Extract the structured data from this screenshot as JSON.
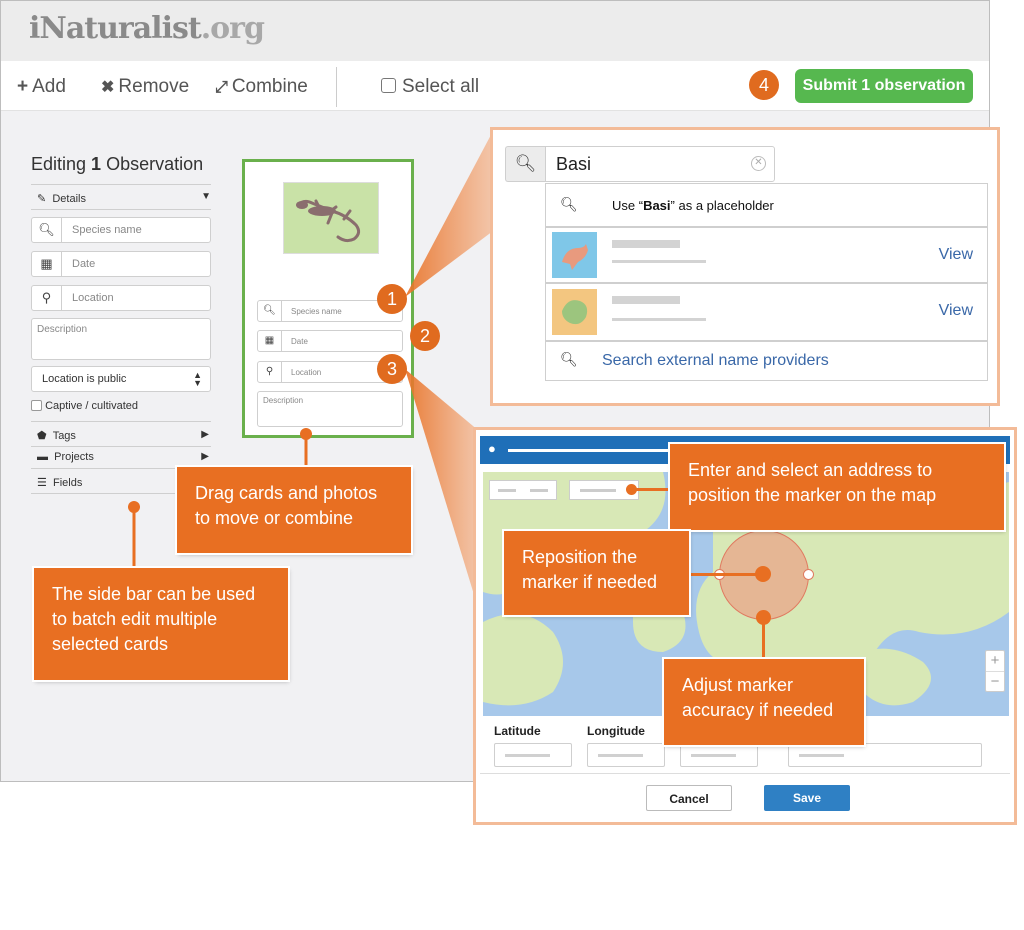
{
  "brand": {
    "name": "iNaturalist",
    "suffix": ".org"
  },
  "toolbar": {
    "add": "Add",
    "remove": "Remove",
    "combine": "Combine",
    "select_all": "Select all",
    "step4": "4",
    "submit": "Submit 1 observation"
  },
  "sidebar": {
    "title_prefix": "Editing ",
    "title_count": "1",
    "title_suffix": " Observation",
    "details": "Details",
    "species_ph": "Species name",
    "date_ph": "Date",
    "location_ph": "Location",
    "description_ph": "Description",
    "location_privacy": "Location is public",
    "captive": "Captive / cultivated",
    "tags": "Tags",
    "projects": "Projects",
    "fields": "Fields"
  },
  "card": {
    "species_ph": "Species name",
    "date_ph": "Date",
    "location_ph": "Location",
    "description_ph": "Description",
    "step1": "1",
    "step2": "2",
    "step3": "3"
  },
  "callouts": {
    "drag": "Drag cards and photos to move or combine",
    "sidebar": "The side bar can be used to batch edit multiple selected cards",
    "address": "Enter and select an address to position the marker on the map",
    "reposition": "Reposition the marker if needed",
    "accuracy": "Adjust marker accuracy if needed"
  },
  "search": {
    "query": "Basi",
    "placeholder_pre": "Use “",
    "placeholder_q": "Basi",
    "placeholder_post": "” as a placeholder",
    "view1": "View",
    "view2": "View",
    "external": "Search external name providers"
  },
  "map": {
    "latitude": "Latitude",
    "longitude": "Longitude",
    "zoom_in": "+",
    "zoom_out": "−",
    "cancel": "Cancel",
    "save": "Save"
  },
  "colors": {
    "accent": "#e86f22",
    "green": "#56b84f",
    "link": "#3a68a8",
    "save": "#2f80c4"
  },
  "icons": [
    "plus-icon",
    "close-icon",
    "combine-icon",
    "checkbox-icon",
    "pencil-icon",
    "caret-down-icon",
    "search-icon",
    "calendar-icon",
    "map-pin-icon",
    "tag-icon",
    "briefcase-icon",
    "list-icon",
    "caret-right-icon",
    "clear-icon"
  ]
}
